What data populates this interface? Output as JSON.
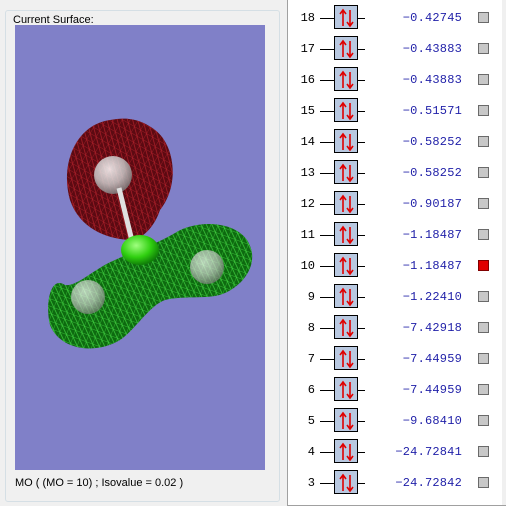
{
  "surface_panel": {
    "title": "Current Surface:",
    "status": "MO ( (MO = 10) ; Isovalue = 0.02 )"
  },
  "colors": {
    "viewport_bg": "#8080c8",
    "positive_lobe": "#7a0010",
    "negative_lobe": "#1aa01a",
    "energy_text": "#1f1fa8",
    "selected_marker": "#e00000"
  },
  "orbitals": [
    {
      "mo": "18",
      "energy": "-0.42745",
      "selected": false
    },
    {
      "mo": "17",
      "energy": "-0.43883",
      "selected": false
    },
    {
      "mo": "16",
      "energy": "-0.43883",
      "selected": false
    },
    {
      "mo": "15",
      "energy": "-0.51571",
      "selected": false
    },
    {
      "mo": "14",
      "energy": "-0.58252",
      "selected": false
    },
    {
      "mo": "13",
      "energy": "-0.58252",
      "selected": false
    },
    {
      "mo": "12",
      "energy": "-0.90187",
      "selected": false
    },
    {
      "mo": "11",
      "energy": "-1.18487",
      "selected": false
    },
    {
      "mo": "10",
      "energy": "-1.18487",
      "selected": true
    },
    {
      "mo": "9",
      "energy": "-1.22410",
      "selected": false
    },
    {
      "mo": "8",
      "energy": "-7.42918",
      "selected": false
    },
    {
      "mo": "7",
      "energy": "-7.44959",
      "selected": false
    },
    {
      "mo": "6",
      "energy": "-7.44959",
      "selected": false
    },
    {
      "mo": "5",
      "energy": "-9.68410",
      "selected": false
    },
    {
      "mo": "4",
      "energy": "-24.72841",
      "selected": false
    },
    {
      "mo": "3",
      "energy": "-24.72842",
      "selected": false
    }
  ],
  "icons": {
    "electron_pair": "up-down-arrows-icon",
    "select": "selection-checkbox-icon"
  }
}
